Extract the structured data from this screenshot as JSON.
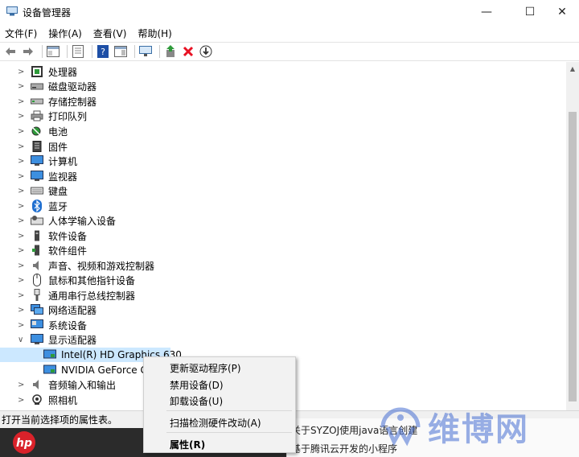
{
  "window": {
    "title": "设备管理器",
    "controls": {
      "minimize": "—",
      "maximize": "☐",
      "close": "✕"
    }
  },
  "menu": [
    "文件(F)",
    "操作(A)",
    "查看(V)",
    "帮助(H)"
  ],
  "toolbar": [
    "back-icon",
    "forward-icon",
    "properties-pane-icon",
    "console-icon",
    "help-icon",
    "show-hide-icon",
    "monitor-icon",
    "update-driver-icon",
    "uninstall-icon",
    "download-icon"
  ],
  "tree": {
    "categories": [
      {
        "label": "处理器",
        "icon": "processor-icon",
        "expanded": false
      },
      {
        "label": "磁盘驱动器",
        "icon": "disk-icon",
        "expanded": false
      },
      {
        "label": "存储控制器",
        "icon": "storage-controller-icon",
        "expanded": false
      },
      {
        "label": "打印队列",
        "icon": "printer-icon",
        "expanded": false
      },
      {
        "label": "电池",
        "icon": "battery-icon",
        "expanded": false
      },
      {
        "label": "固件",
        "icon": "firmware-icon",
        "expanded": false
      },
      {
        "label": "计算机",
        "icon": "computer-icon",
        "expanded": false
      },
      {
        "label": "监视器",
        "icon": "monitor-icon",
        "expanded": false
      },
      {
        "label": "键盘",
        "icon": "keyboard-icon",
        "expanded": false
      },
      {
        "label": "蓝牙",
        "icon": "bluetooth-icon",
        "expanded": false
      },
      {
        "label": "人体学输入设备",
        "icon": "hid-icon",
        "expanded": false
      },
      {
        "label": "软件设备",
        "icon": "software-device-icon",
        "expanded": false
      },
      {
        "label": "软件组件",
        "icon": "software-component-icon",
        "expanded": false
      },
      {
        "label": "声音、视频和游戏控制器",
        "icon": "sound-icon",
        "expanded": false
      },
      {
        "label": "鼠标和其他指针设备",
        "icon": "mouse-icon",
        "expanded": false
      },
      {
        "label": "通用串行总线控制器",
        "icon": "usb-icon",
        "expanded": false
      },
      {
        "label": "网络适配器",
        "icon": "network-icon",
        "expanded": false
      },
      {
        "label": "系统设备",
        "icon": "system-device-icon",
        "expanded": false
      },
      {
        "label": "显示适配器",
        "icon": "display-adapter-icon",
        "expanded": true
      },
      {
        "label": "音频输入和输出",
        "icon": "audio-io-icon",
        "expanded": false
      },
      {
        "label": "照相机",
        "icon": "camera-icon",
        "expanded": false
      }
    ],
    "display_children": [
      {
        "label": "Intel(R) HD Graphics 630",
        "selected": true
      },
      {
        "label": "NVIDIA GeForce GT",
        "selected": false
      }
    ]
  },
  "context_menu": {
    "items": [
      "更新驱动程序(P)",
      "禁用设备(D)",
      "卸载设备(U)",
      "扫描检测硬件改动(A)",
      "属性(R)"
    ]
  },
  "status": "打开当前选择项的属性表。",
  "background": {
    "line1": "关于SYZOJ使用java语言创建",
    "line2": "基于腾讯云开发的小程序",
    "watermark": "维博网"
  },
  "colors": {
    "selection": "#cce8ff",
    "close_red": "#e81123",
    "help_blue": "#1e4fa6",
    "green": "#2e9a3a"
  }
}
